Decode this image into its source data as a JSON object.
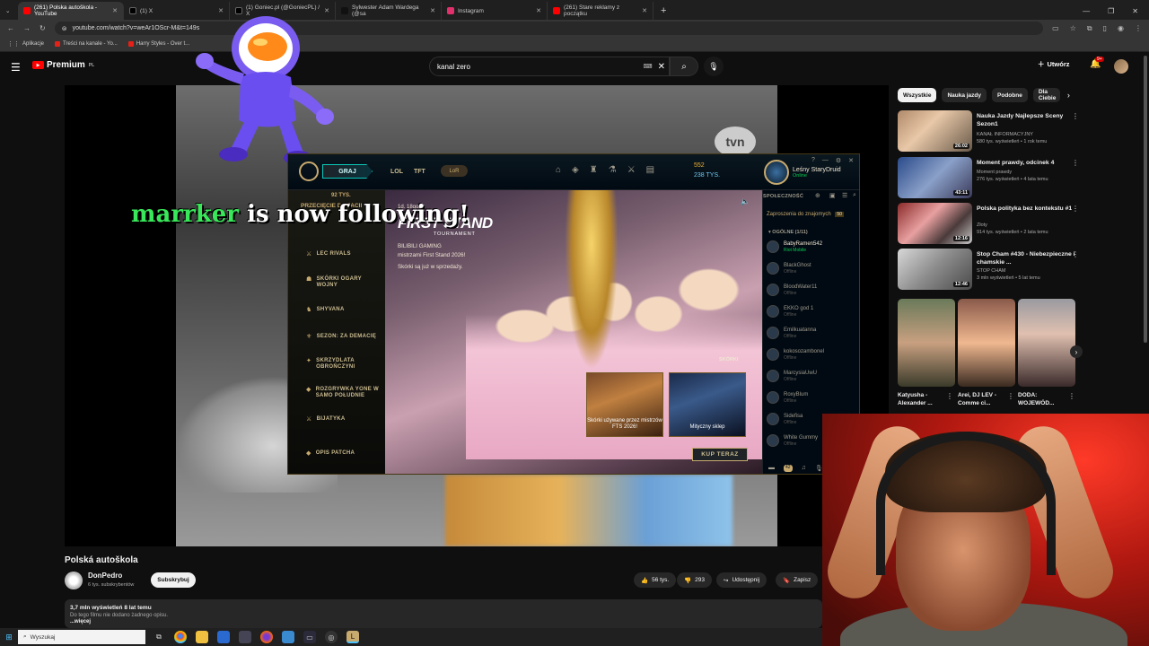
{
  "browser": {
    "tabs": [
      {
        "label": "(261) Polska autoškola - YouTube",
        "favicon_color": "#ff0000",
        "active": true
      },
      {
        "label": "(1) X",
        "favicon_color": "#000000",
        "active": false
      },
      {
        "label": "(1) Goniec.pl (@GoniecPL) / X",
        "favicon_color": "#000000",
        "active": false
      },
      {
        "label": "Sylwester Adam Wardega (@sa",
        "favicon_color": "#111111",
        "active": false
      },
      {
        "label": "Instagram",
        "favicon_color": "#e1306c",
        "active": false
      },
      {
        "label": "(261) Stare reklamy z początku",
        "favicon_color": "#ff0000",
        "active": false
      }
    ],
    "new_tab": "+",
    "window_controls": [
      "—",
      "❐",
      "✕"
    ],
    "url": "youtube.com/watch?v=weAr1OScr-M&t=149s",
    "bookmarks": [
      {
        "label": "Aplikacje",
        "icon": "apps-grid-icon"
      },
      {
        "label": "Treści na kanale - Yo...",
        "icon": "youtube-icon"
      },
      {
        "label": "Harry Styles - Over t...",
        "icon": "youtube-icon"
      }
    ]
  },
  "youtube": {
    "logo_text": "Premium",
    "logo_sup": "PL",
    "search_value": "kanal zero",
    "create_label": "Utwórz",
    "notif_count": "9+"
  },
  "overlay": {
    "follower_name": "marrker",
    "follow_text": " is now following!",
    "tvn_logo": "tvn"
  },
  "lol": {
    "play_button": "GRAJ",
    "tabs": [
      "LOL",
      "TFT"
    ],
    "lor_label": "LoR",
    "rp": "552",
    "be": "238 TYS.",
    "profile_name": "Leśny StaryDruid",
    "profile_status": "Online",
    "left_top": "92 TYS.",
    "left_items": [
      "PRZECIĘCIE DEMACII",
      "LEC RIVALS",
      "SKÓRKI OGARY WOJNY",
      "SHYVANA",
      "SEZON: ZA DEMACIĘ",
      "SKRZYDLATA OBROŃCZYNI",
      "ROZGRYWKA YONE W SAMO POŁUDNIE",
      "BIJATYKA",
      "OPIS PATCHA"
    ],
    "banner_date": "1d. 18godz.",
    "banner_title": "FIRST STAND",
    "banner_subtitle": "TOURNAMENT",
    "banner_desc_1": "BILIBILI GAMING",
    "banner_desc_2": "mistrzami First Stand 2026!",
    "banner_desc_3": "Skórki są już w sprzedaży.",
    "skorki_label": "SKÓRKI",
    "card_1": "Skórki używane przez mistrzów FTS 2026!",
    "card_2": "Mityczny sklep",
    "buy_button": "KUP TERAZ",
    "social_header": "SPOŁECZNOŚĆ",
    "invites": "Zaproszenia do znajomych",
    "invites_count": "50",
    "group_label": "OGÓLNE (1/11)",
    "friends": [
      {
        "name": "BabyRamen542",
        "status": "Riot Mobile",
        "online": true
      },
      {
        "name": "BlackGhost",
        "status": "Offline",
        "online": false
      },
      {
        "name": "BloodWater11",
        "status": "Offline",
        "online": false
      },
      {
        "name": "EKKO god 1",
        "status": "Offline",
        "online": false
      },
      {
        "name": "Emilkuatanna",
        "status": "Offline",
        "online": false
      },
      {
        "name": "kokosozambonel",
        "status": "Offline",
        "online": false
      },
      {
        "name": "MarcysiaUwU",
        "status": "Offline",
        "online": false
      },
      {
        "name": "RoxyBlum",
        "status": "Offline",
        "online": false
      },
      {
        "name": "Sidefisa",
        "status": "Offline",
        "online": false
      },
      {
        "name": "White Gummy",
        "status": "Offline",
        "online": false
      }
    ],
    "chat_badge": "42"
  },
  "video": {
    "title": "Polská autoškola",
    "channel": "DonPedro",
    "subs": "6 tys. subskrybentów",
    "subscribe": "Subskrybuj",
    "likes": "56 tys.",
    "dislikes": "293",
    "share": "Udostępnij",
    "save": "Zapisz",
    "views": "3,7 mln wyświetleń  8 lat temu",
    "no_desc": "Do tego filmu nie dodano żadnego opisu.",
    "more": "...więcej"
  },
  "sidebar": {
    "chips": [
      "Wszystkie",
      "Nauka jazdy",
      "Podobne",
      "Dla Ciebie"
    ],
    "recs": [
      {
        "title": "Nauka Jazdy Najlepsze Sceny Sezon1",
        "channel": "KANAŁ INFORMACYJNY",
        "meta": "580 tys. wyświetleń • 1 rok temu",
        "duration": "26:02"
      },
      {
        "title": "Moment prawdy, odcinek 4",
        "channel": "Moment prawdy",
        "meta": "276 tys. wyświetleń • 4 lata temu",
        "duration": "43:11"
      },
      {
        "title": "Polska polityka bez kontekstu #1",
        "channel": "Złoty",
        "meta": "914 tys. wyświetleń • 2 lata temu",
        "duration": "12:16"
      },
      {
        "title": "Stop Cham #430 - Niebezpieczne i chamskie ...",
        "channel": "STOP CHAM",
        "meta": "3 mln wyświetleń • 5 lat temu",
        "duration": "12:46"
      }
    ],
    "shorts": [
      {
        "title": "Katyusha - Alexander ..."
      },
      {
        "title": "Arei, DJ LEV - Comme ci..."
      },
      {
        "title": "DODA: WOJEWÓD..."
      }
    ]
  },
  "taskbar": {
    "search_placeholder": "Wyszukaj"
  }
}
